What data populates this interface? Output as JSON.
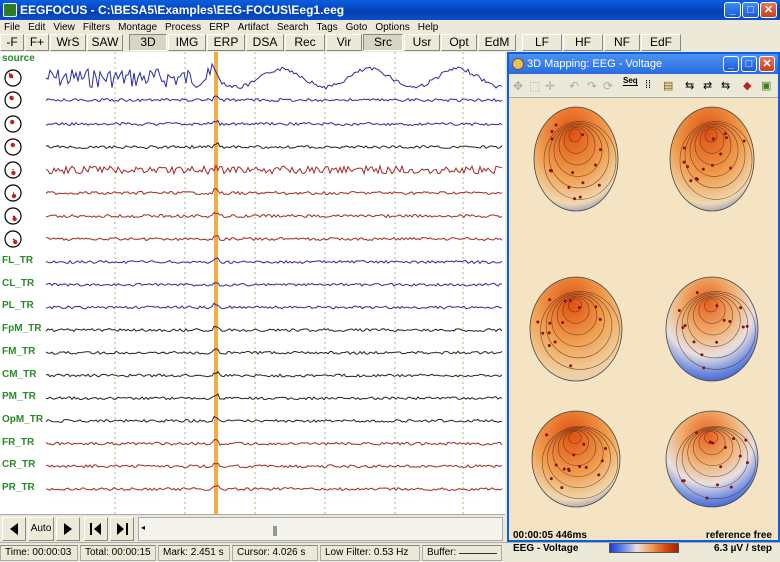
{
  "window": {
    "title": "EEGFOCUS - C:\\BESA5\\Examples\\EEG-FOCUS\\Eeg1.eeg"
  },
  "menu": [
    "File",
    "Edit",
    "View",
    "Filters",
    "Montage",
    "Process",
    "ERP",
    "Artifact",
    "Search",
    "Tags",
    "Goto",
    "Options",
    "Help"
  ],
  "toolbar": [
    {
      "label": "-F",
      "pressed": false
    },
    {
      "label": "F+",
      "pressed": false
    },
    {
      "label": "WrS",
      "pressed": false
    },
    {
      "label": "SAW",
      "pressed": false
    },
    {
      "label": "3D",
      "pressed": true
    },
    {
      "label": "IMG",
      "pressed": false
    },
    {
      "label": "ERP",
      "pressed": false
    },
    {
      "label": "DSA",
      "pressed": false
    },
    {
      "label": "Rec",
      "pressed": false
    },
    {
      "label": "Vir",
      "pressed": false
    },
    {
      "label": "Src",
      "pressed": true
    },
    {
      "label": "Usr",
      "pressed": false
    },
    {
      "label": "Opt",
      "pressed": false
    },
    {
      "label": "EdM",
      "pressed": false
    },
    {
      "label": "LF",
      "pressed": false
    },
    {
      "label": "HF",
      "pressed": false
    },
    {
      "label": "NF",
      "pressed": false
    },
    {
      "label": "EdF",
      "pressed": false
    }
  ],
  "eeg": {
    "source_label": "source",
    "channels": [
      "FL_TR",
      "CL_TR",
      "PL_TR",
      "FpM_TR",
      "FM_TR",
      "CM_TR",
      "PM_TR",
      "OpM_TR",
      "FR_TR",
      "CR_TR",
      "PR_TR"
    ]
  },
  "navigation": {
    "auto_label": "Auto"
  },
  "status": {
    "time": "Time: 00:00:03",
    "total": "Total: 00:00:15",
    "mark": "Mark: 2.451 s",
    "cursor": "Cursor: 4.026 s",
    "lowfilter": "Low Filter: 0.53 Hz",
    "buffer": "Buffer:"
  },
  "mapping": {
    "title": "3D Mapping: EEG - Voltage",
    "seq_label": "Seq",
    "time": "00:00:05 446ms",
    "reference": "reference free",
    "type": "EEG - Voltage",
    "scale": "6.3 µV / step"
  },
  "colors": {
    "cursor_line": "#f0a020",
    "blue_trace": "#2a2aa0",
    "red_trace": "#a02828",
    "black_trace": "#222222",
    "label_green": "#2a8a2a"
  }
}
